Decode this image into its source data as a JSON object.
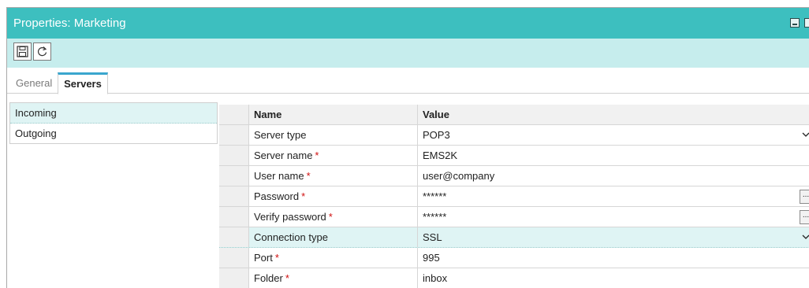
{
  "window": {
    "title": "Properties: Marketing"
  },
  "toolbar": {
    "buttons": [
      {
        "icon": "save-icon"
      },
      {
        "icon": "refresh-icon"
      }
    ]
  },
  "tabs": [
    {
      "label": "General",
      "active": false
    },
    {
      "label": "Servers",
      "active": true
    }
  ],
  "server_list": [
    {
      "label": "Incoming",
      "selected": true
    },
    {
      "label": "Outgoing",
      "selected": false
    }
  ],
  "grid": {
    "headers": {
      "name": "Name",
      "value": "Value"
    },
    "rows": [
      {
        "name": "Server type",
        "required": false,
        "value": "POP3",
        "control": "dropdown"
      },
      {
        "name": "Server name",
        "required": true,
        "value": "EMS2K",
        "control": "text"
      },
      {
        "name": "User name",
        "required": true,
        "value": "user@company",
        "control": "text"
      },
      {
        "name": "Password",
        "required": true,
        "value": "******",
        "control": "ellipsis"
      },
      {
        "name": "Verify password",
        "required": true,
        "value": "******",
        "control": "ellipsis"
      },
      {
        "name": "Connection type",
        "required": false,
        "value": "SSL",
        "control": "dropdown"
      },
      {
        "name": "Port",
        "required": true,
        "value": "995",
        "control": "text"
      },
      {
        "name": "Folder",
        "required": true,
        "value": "inbox",
        "control": "text"
      }
    ],
    "required_marker": "*",
    "ellipsis_label": "..."
  },
  "colors": {
    "titlebar": "#3dbfbf",
    "toolbar": "#c6eded",
    "selection": "#dff4f4",
    "tab_accent": "#3aa6ce",
    "required": "#d01010"
  }
}
